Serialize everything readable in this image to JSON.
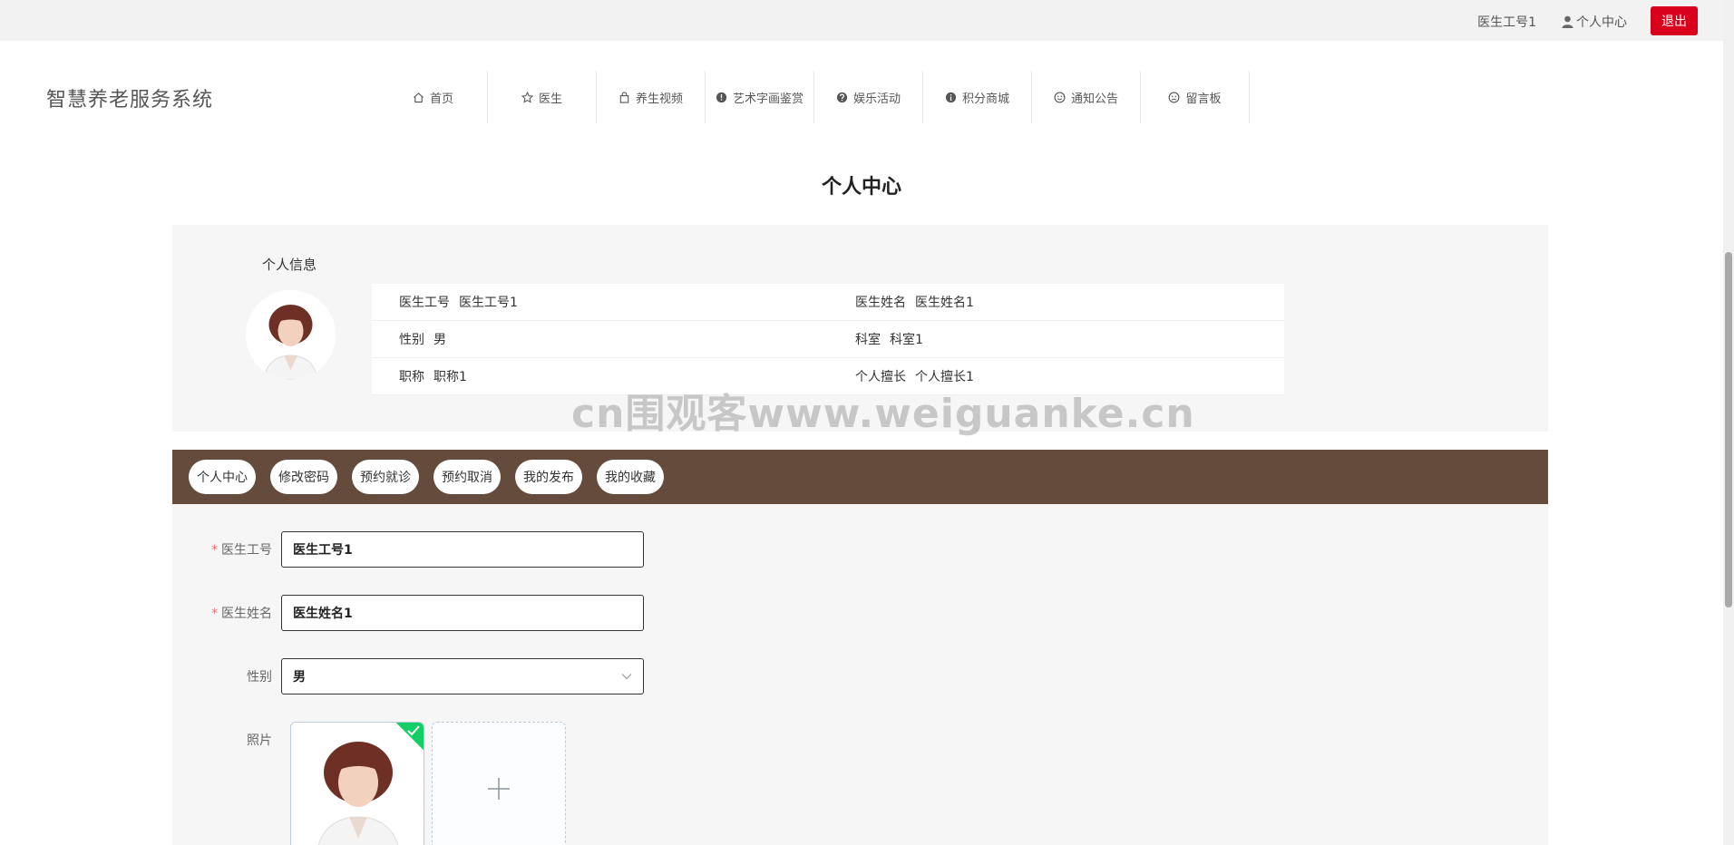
{
  "topbar": {
    "user_no": "医生工号1",
    "center_label": "个人中心",
    "logout_label": "退出"
  },
  "brand": "智慧养老服务系统",
  "nav": [
    {
      "label": "首页",
      "icon": "home-icon"
    },
    {
      "label": "医生",
      "icon": "star-icon"
    },
    {
      "label": "养生视频",
      "icon": "bag-icon"
    },
    {
      "label": "艺术字画鉴赏",
      "icon": "warning-icon"
    },
    {
      "label": "娱乐活动",
      "icon": "question-icon"
    },
    {
      "label": "积分商城",
      "icon": "info-icon"
    },
    {
      "label": "通知公告",
      "icon": "smile-icon"
    },
    {
      "label": "留言板",
      "icon": "sad-icon"
    }
  ],
  "page_title": "个人中心",
  "info": {
    "heading": "个人信息",
    "rows": [
      [
        {
          "k": "医生工号",
          "v": "医生工号1"
        },
        {
          "k": "医生姓名",
          "v": "医生姓名1"
        }
      ],
      [
        {
          "k": "性别",
          "v": "男"
        },
        {
          "k": "科室",
          "v": "科室1"
        }
      ],
      [
        {
          "k": "职称",
          "v": "职称1"
        },
        {
          "k": "个人擅长",
          "v": "个人擅长1"
        }
      ]
    ]
  },
  "watermark": "cn围观客www.weiguanke.cn",
  "tabs": [
    "个人中心",
    "修改密码",
    "预约就诊",
    "预约取消",
    "我的发布",
    "我的收藏"
  ],
  "form": {
    "doctor_no_label": "医生工号",
    "doctor_no_value": "医生工号1",
    "doctor_name_label": "医生姓名",
    "doctor_name_value": "医生姓名1",
    "gender_label": "性别",
    "gender_value": "男",
    "photo_label": "照片"
  },
  "colors": {
    "logout_bg": "#d9001b",
    "tabbar_bg": "#654b3c",
    "success": "#13ce66",
    "required": "#f56c6c"
  }
}
